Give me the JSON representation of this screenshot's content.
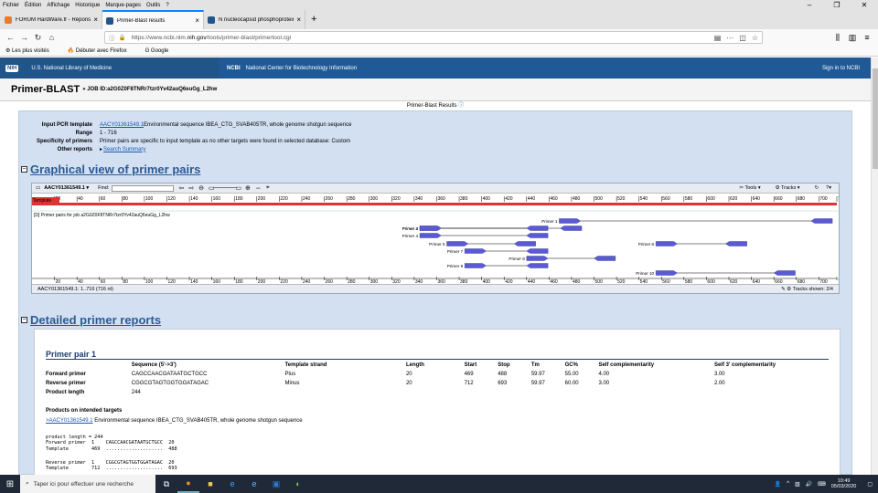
{
  "menu": [
    "Fichier",
    "Édition",
    "Affichage",
    "Historique",
    "Marque-pages",
    "Outils",
    "?"
  ],
  "tabs": [
    {
      "label": "FORUM HardWare.fr - Réponse",
      "color": "#e87b2a"
    },
    {
      "label": "Primer-Blast results",
      "color": "#20558a"
    },
    {
      "label": "N nucleocapsid phosphoprotein [Se",
      "color": "#20558a"
    }
  ],
  "url": {
    "prefix": "https://www.ncbi.nlm.",
    "domain": "nih.gov",
    "path": "/tools/primer-blast/primertool.cgi"
  },
  "bookmarks": [
    "Les plus visités",
    "Débuter avec Firefox",
    "Google"
  ],
  "nih": {
    "logo": "NIH",
    "name": "U.S. National Library of Medicine",
    "ncbi": "NCBI",
    "center": "National Center for Biotechnology Information",
    "signin": "Sign in to NCBI"
  },
  "page": {
    "title": "Primer-BLAST",
    "job": "» JOB ID:a2G0Z0F8TNRr7tzr0Yv42auQ6euGg_L2hw",
    "results": "Primer-Blast Results"
  },
  "summary": {
    "template_k": "Input PCR template",
    "template_link": "AACY01361549.1",
    "template_desc": " Environmental sequence IBEA_CTG_SVAB405TR, whole genome shotgun sequence",
    "range_k": "Range",
    "range_v": "1 - 716",
    "spec_k": "Specificity of primers",
    "spec_v": "Primer pairs are specific to input template as no other targets were found in selected database: Custom",
    "other_k": "Other reports",
    "other_v": "Search Summary"
  },
  "graph": {
    "heading": "Graphical view of primer pairs",
    "seq": "AACY01361549.1 ▾",
    "find": "Find:",
    "tools": "Tools ▾",
    "tracks": "Tracks ▾",
    "track_title": "[D]  Primer pairs for job a2G0Z0F8TNRr7tzr0Yv42auQ6euGg_L2hw",
    "template_label": "Template",
    "status": "AACY01361549.1: 1..716 (716 nt)",
    "shown": "Tracks shown: 2/4",
    "ticks": [
      20,
      40,
      60,
      80,
      100,
      120,
      140,
      160,
      180,
      200,
      220,
      240,
      260,
      280,
      300,
      320,
      340,
      360,
      380,
      400,
      420,
      440,
      460,
      480,
      500,
      520,
      540,
      560,
      580,
      600,
      620,
      640,
      660,
      680,
      700,
      716
    ],
    "length": 716,
    "primers": [
      {
        "label": "Primer 1",
        "fwd": [
          469,
          488
        ],
        "rev": [
          693,
          712
        ]
      },
      {
        "label": "Primer 2",
        "fwd": [
          345,
          364
        ],
        "rev": [
          470,
          489
        ]
      },
      {
        "label": "Primer 3",
        "fwd": [
          345,
          364
        ],
        "rev": [
          440,
          459
        ]
      },
      {
        "label": "Primer 4",
        "fwd": [
          345,
          364
        ],
        "rev": [
          440,
          459
        ]
      },
      {
        "label": "Primer 5",
        "fwd": [
          369,
          388
        ],
        "rev": [
          429,
          448
        ]
      },
      {
        "label": "Primer 6",
        "fwd": [
          555,
          574
        ],
        "rev": [
          617,
          636
        ]
      },
      {
        "label": "Primer 7",
        "fwd": [
          385,
          404
        ],
        "rev": [
          440,
          459
        ]
      },
      {
        "label": "Primer 8",
        "fwd": [
          440,
          459
        ],
        "rev": [
          500,
          519
        ]
      },
      {
        "label": "Primer 9",
        "fwd": [
          385,
          404
        ],
        "rev": [
          440,
          459
        ]
      },
      {
        "label": "Primer 10",
        "fwd": [
          555,
          574
        ],
        "rev": [
          660,
          679
        ]
      }
    ]
  },
  "detail": {
    "heading": "Detailed primer reports",
    "pair": "Primer pair 1",
    "cols": [
      "",
      "Sequence (5'->3')",
      "Template strand",
      "Length",
      "Start",
      "Stop",
      "Tm",
      "GC%",
      "Self complementarity",
      "Self 3' complementarity"
    ],
    "rows": [
      [
        "Forward primer",
        "CAGCCAACGATAATGCTGCC",
        "Plus",
        "20",
        "469",
        "488",
        "59.97",
        "55.00",
        "4.00",
        "3.00"
      ],
      [
        "Reverse primer",
        "CGGCGTAGTGGTGGATAGAC",
        "Minus",
        "20",
        "712",
        "693",
        "59.97",
        "60.00",
        "3.00",
        "2.00"
      ],
      [
        "Product length",
        "244",
        "",
        "",
        "",
        "",
        "",
        "",
        "",
        ""
      ]
    ],
    "products": "Products on intended targets",
    "prod_link": ">AACY01361549.1",
    "prod_desc": " Environmental sequence IBEA_CTG_SVAB405TR, whole genome shotgun sequence",
    "align1": "product length = 244\nForward primer  1    CAGCCAACGATAATGCTGCC  20\nTemplate        469  ....................  488",
    "align2": "Reverse primer  1    CGGCGTAGTGGTGGATAGAC  20\nTemplate        712  ....................  693"
  },
  "taskbar": {
    "search": "Taper ici pour effectuer une recherche",
    "time": "10:49",
    "date": "05/03/2020"
  }
}
